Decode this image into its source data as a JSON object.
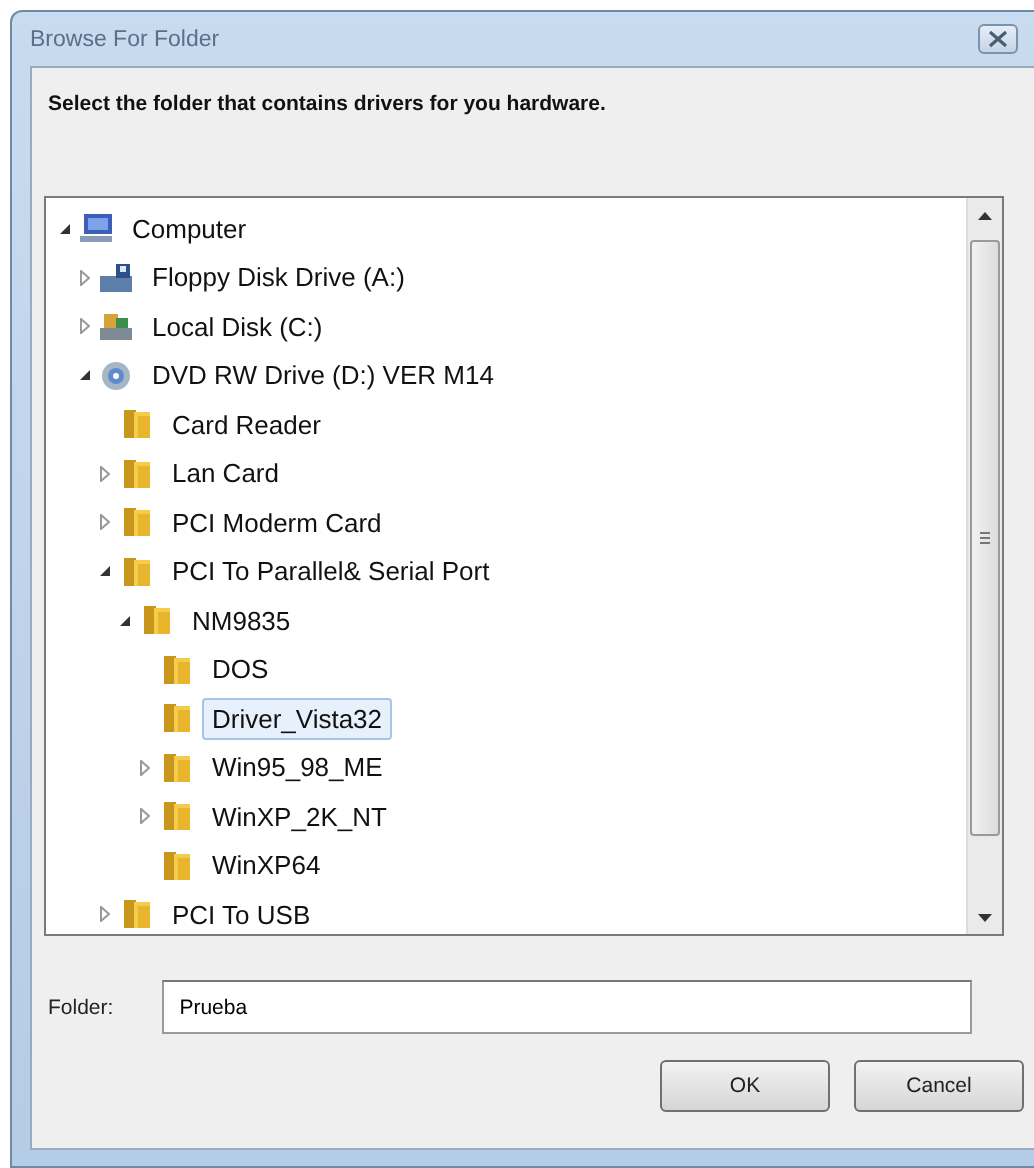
{
  "window": {
    "title": "Browse For Folder"
  },
  "instruction": "Select the folder that contains drivers for you hardware.",
  "tree": [
    {
      "label": "Computer",
      "kind": "computer",
      "expanded": true,
      "selected": false,
      "children": [
        {
          "label": "Floppy Disk Drive (A:)",
          "kind": "floppy",
          "expanded": false,
          "selected": false
        },
        {
          "label": "Local Disk (C:)",
          "kind": "disk",
          "expanded": false,
          "selected": false
        },
        {
          "label": "DVD RW Drive (D:) VER M14",
          "kind": "dvd",
          "expanded": true,
          "selected": false,
          "children": [
            {
              "label": "Card Reader",
              "kind": "folder",
              "selected": false
            },
            {
              "label": "Lan Card",
              "kind": "folder",
              "expanded": false,
              "selected": false
            },
            {
              "label": "PCI Moderm Card",
              "kind": "folder",
              "expanded": false,
              "selected": false
            },
            {
              "label": "PCI To Parallel& Serial Port",
              "kind": "folder",
              "expanded": true,
              "selected": false,
              "children": [
                {
                  "label": "NM9835",
                  "kind": "folder",
                  "expanded": true,
                  "selected": false,
                  "children": [
                    {
                      "label": "DOS",
                      "kind": "folder",
                      "selected": false
                    },
                    {
                      "label": "Driver_Vista32",
                      "kind": "folder",
                      "selected": true
                    },
                    {
                      "label": "Win95_98_ME",
                      "kind": "folder",
                      "expanded": false,
                      "selected": false
                    },
                    {
                      "label": "WinXP_2K_NT",
                      "kind": "folder",
                      "expanded": false,
                      "selected": false
                    },
                    {
                      "label": "WinXP64",
                      "kind": "folder",
                      "selected": false
                    }
                  ]
                }
              ]
            },
            {
              "label": "PCI To USB",
              "kind": "folder",
              "expanded": false,
              "selected": false
            }
          ]
        }
      ]
    }
  ],
  "folder_field": {
    "label": "Folder:",
    "value": "Prueba"
  },
  "buttons": [
    {
      "label": "OK"
    },
    {
      "label": "Cancel"
    }
  ]
}
